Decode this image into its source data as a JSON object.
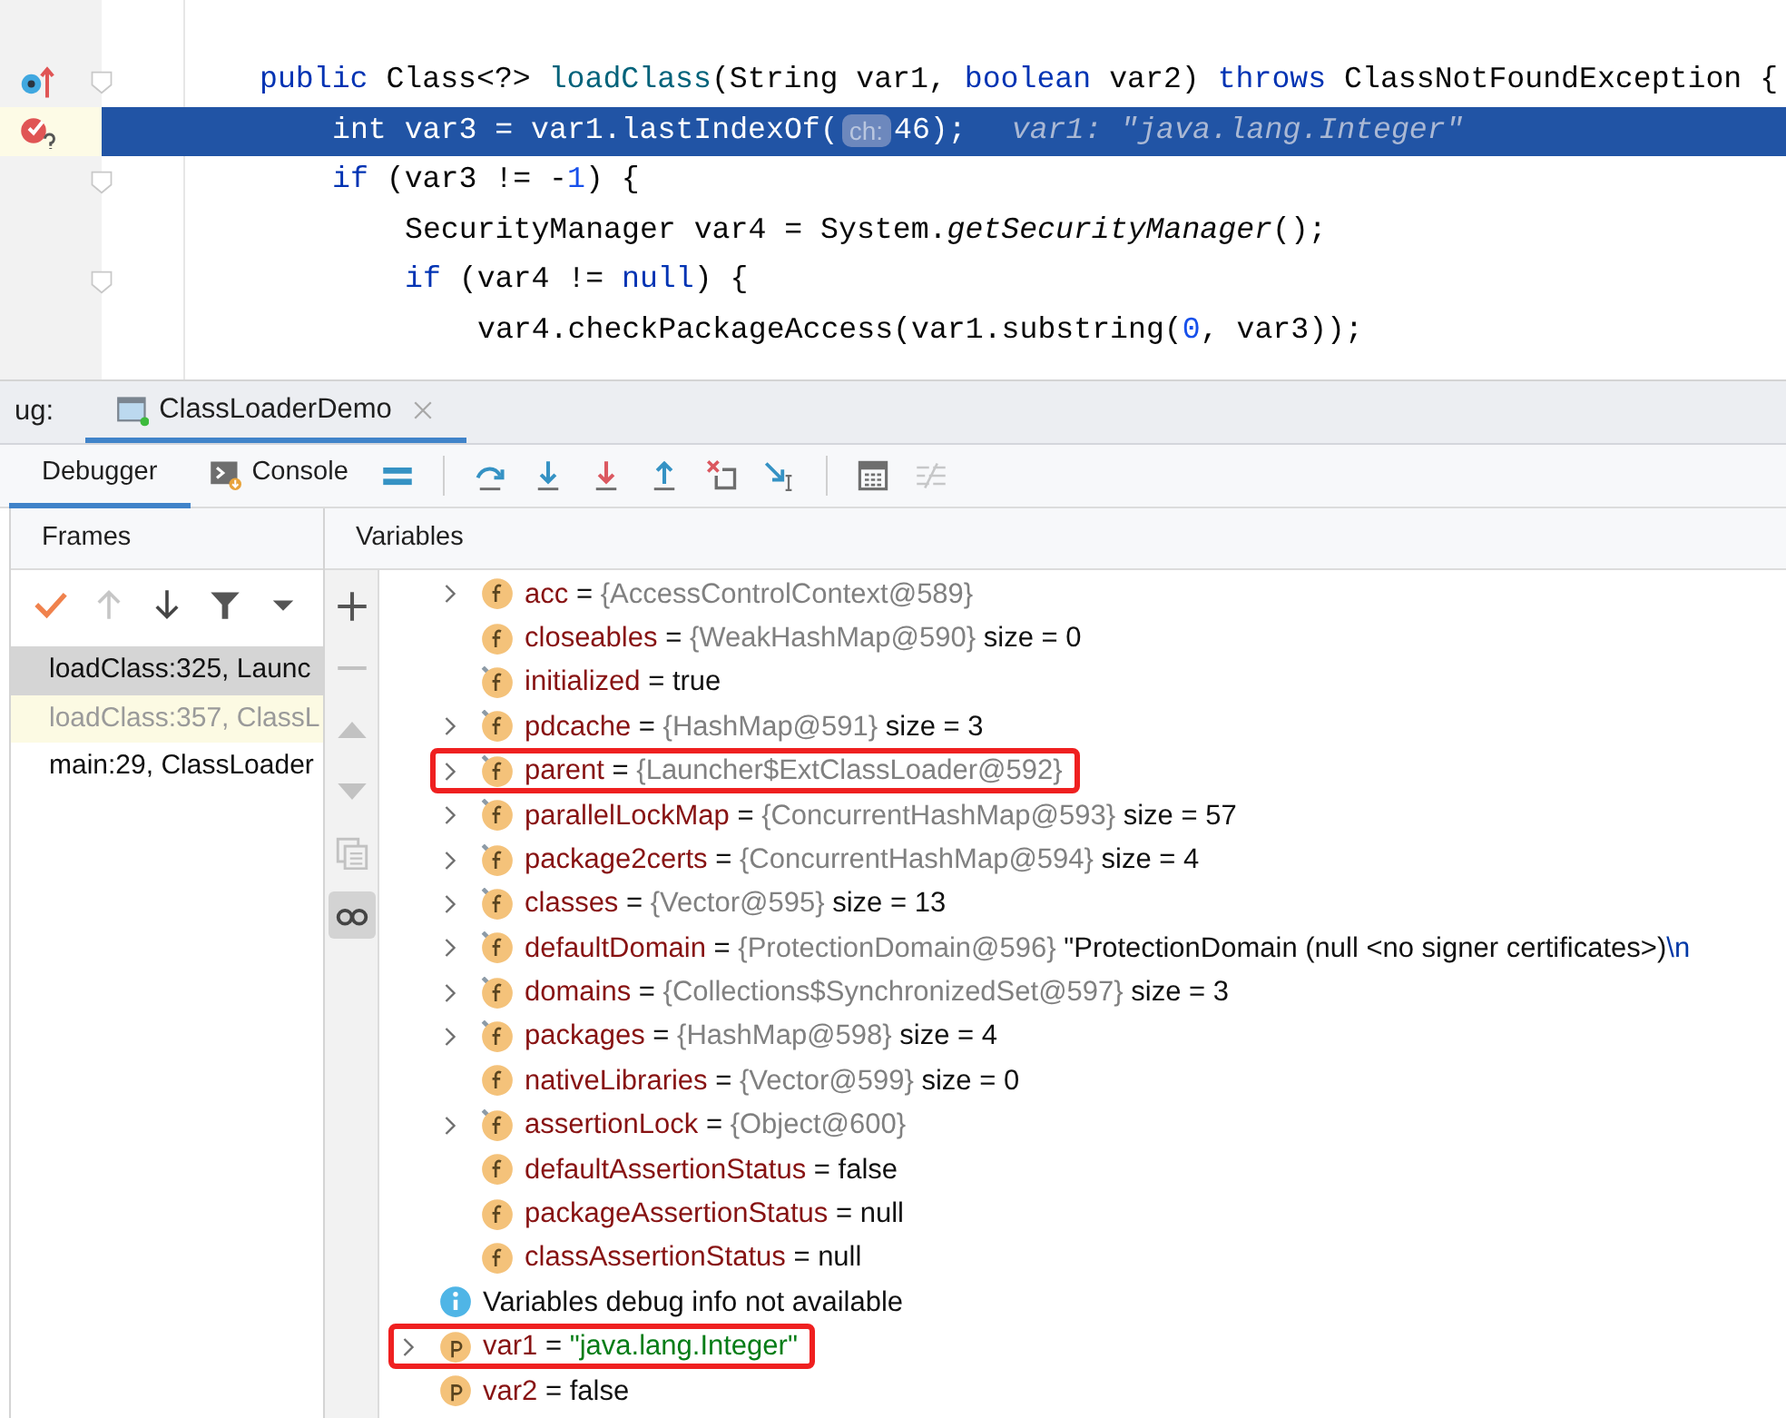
{
  "editor": {
    "lines": [
      {
        "kind": "override",
        "fold": true,
        "current": false,
        "tokens": [
          {
            "text": "public",
            "kind": "keyword"
          },
          {
            "text": " Class<?> ",
            "kind": "plain"
          },
          {
            "text": "loadClass",
            "kind": "declaration"
          },
          {
            "text": "(String var1, ",
            "kind": "plain"
          },
          {
            "text": "boolean",
            "kind": "keyword"
          },
          {
            "text": " var2) ",
            "kind": "plain"
          },
          {
            "text": "throws",
            "kind": "keyword"
          },
          {
            "text": " ClassNotFoundException {",
            "kind": "plain"
          }
        ],
        "children": [
          {
            "kind": "breakpoint",
            "fold": false,
            "current": true,
            "tokens": [
              {
                "text": "int",
                "kind": "keyword"
              },
              {
                "text": " var3 = var1.lastIndexOf(",
                "kind": "plain"
              },
              {
                "text": "ch:",
                "kind": "hint"
              },
              {
                "text": "46);",
                "kind": "plain"
              },
              {
                "text": "var1: \"java.lang.Integer\"",
                "kind": "inline_value"
              }
            ]
          },
          {
            "kind": "plain",
            "fold": true,
            "current": false,
            "tokens": [
              {
                "text": "if",
                "kind": "keyword"
              },
              {
                "text": " (var3 != -",
                "kind": "plain"
              },
              {
                "text": "1",
                "kind": "number"
              },
              {
                "text": ") {",
                "kind": "plain"
              }
            ],
            "children": [
              {
                "fold": false,
                "current": false,
                "tokens": [
                  {
                    "text": "SecurityManager var4 = System.",
                    "kind": "plain"
                  },
                  {
                    "text": "getSecurityManager",
                    "kind": "italic"
                  },
                  {
                    "text": "();",
                    "kind": "plain"
                  }
                ]
              },
              {
                "fold": true,
                "current": false,
                "tokens": [
                  {
                    "text": "if",
                    "kind": "keyword"
                  },
                  {
                    "text": " (var4 != ",
                    "kind": "plain"
                  },
                  {
                    "text": "null",
                    "kind": "keyword"
                  },
                  {
                    "text": ") {",
                    "kind": "plain"
                  }
                ],
                "children": [
                  {
                    "fold": false,
                    "current": false,
                    "tokens": [
                      {
                        "text": "var4.checkPackageAccess(var1.substring(",
                        "kind": "plain"
                      },
                      {
                        "text": "0",
                        "kind": "number"
                      },
                      {
                        "text": ", var3));",
                        "kind": "plain"
                      }
                    ]
                  }
                ]
              }
            ]
          }
        ]
      }
    ]
  },
  "debug_bar": {
    "label": "ug:",
    "tab": {
      "title": "ClassLoaderDemo",
      "selected": true
    }
  },
  "toolbar": {
    "tabs": [
      {
        "label": "Debugger",
        "kind": "plain",
        "selected": true
      },
      {
        "label": "Console",
        "kind": "console",
        "selected": false
      }
    ],
    "actions": [
      {
        "kind": "menu",
        "disabled": false
      },
      {
        "kind": "separator"
      },
      {
        "kind": "step_over",
        "disabled": false
      },
      {
        "kind": "step_into",
        "disabled": false
      },
      {
        "kind": "force_step_into",
        "disabled": false
      },
      {
        "kind": "step_out",
        "disabled": false
      },
      {
        "kind": "drop_frame",
        "disabled": false
      },
      {
        "kind": "run_to_cursor",
        "disabled": false
      },
      {
        "kind": "separator"
      },
      {
        "kind": "evaluate",
        "disabled": false
      },
      {
        "kind": "trace",
        "disabled": true
      }
    ]
  },
  "frames": {
    "title": "Frames",
    "tools": [
      {
        "kind": "check",
        "disabled": false
      },
      {
        "kind": "up",
        "disabled": true
      },
      {
        "kind": "down",
        "disabled": false
      },
      {
        "kind": "filter",
        "disabled": false
      },
      {
        "kind": "dropdown",
        "disabled": false
      }
    ],
    "items": [
      {
        "label": "loadClass:325, Launc",
        "selected": true,
        "library": false
      },
      {
        "label": "loadClass:357, ClassL",
        "selected": false,
        "library": true
      },
      {
        "label": "main:29, ClassLoader",
        "selected": false,
        "library": false
      }
    ]
  },
  "variables": {
    "title": "Variables",
    "tools": [
      {
        "kind": "plus",
        "disabled": false,
        "selected": false
      },
      {
        "kind": "minus",
        "disabled": true,
        "selected": false
      },
      {
        "kind": "up",
        "disabled": true,
        "selected": false
      },
      {
        "kind": "down",
        "disabled": true,
        "selected": false
      },
      {
        "kind": "copy",
        "disabled": true,
        "selected": false
      },
      {
        "kind": "glasses",
        "disabled": false,
        "selected": true
      }
    ],
    "fields_of_scrolled_object": [
      {
        "kind": "field",
        "final": false,
        "expandable": true,
        "annotated": false,
        "name": "acc",
        "value": [
          {
            "text": "=",
            "kind": "plain"
          },
          {
            "text": "{AccessControlContext@589}",
            "kind": "object"
          }
        ]
      },
      {
        "kind": "field",
        "final": false,
        "expandable": false,
        "annotated": false,
        "name": "closeables",
        "value": [
          {
            "text": "=",
            "kind": "plain"
          },
          {
            "text": "{WeakHashMap@590}",
            "kind": "object"
          },
          {
            "text": "size = 0",
            "kind": "plain"
          }
        ]
      },
      {
        "kind": "field",
        "final": true,
        "expandable": false,
        "annotated": false,
        "name": "initialized",
        "value": [
          {
            "text": "=",
            "kind": "plain"
          },
          {
            "text": "true",
            "kind": "plain"
          }
        ]
      },
      {
        "kind": "field",
        "final": true,
        "expandable": true,
        "annotated": false,
        "name": "pdcache",
        "value": [
          {
            "text": "=",
            "kind": "plain"
          },
          {
            "text": "{HashMap@591}",
            "kind": "object"
          },
          {
            "text": "size = 3",
            "kind": "plain"
          }
        ]
      },
      {
        "kind": "field",
        "final": true,
        "expandable": true,
        "annotated": true,
        "name": "parent",
        "value": [
          {
            "text": "=",
            "kind": "plain"
          },
          {
            "text": "{Launcher$ExtClassLoader@592}",
            "kind": "object"
          }
        ]
      },
      {
        "kind": "field",
        "final": true,
        "expandable": true,
        "annotated": false,
        "name": "parallelLockMap",
        "value": [
          {
            "text": "=",
            "kind": "plain"
          },
          {
            "text": "{ConcurrentHashMap@593}",
            "kind": "object"
          },
          {
            "text": "size = 57",
            "kind": "plain"
          }
        ]
      },
      {
        "kind": "field",
        "final": true,
        "expandable": true,
        "annotated": false,
        "name": "package2certs",
        "value": [
          {
            "text": "=",
            "kind": "plain"
          },
          {
            "text": "{ConcurrentHashMap@594}",
            "kind": "object"
          },
          {
            "text": "size = 4",
            "kind": "plain"
          }
        ]
      },
      {
        "kind": "field",
        "final": true,
        "expandable": true,
        "annotated": false,
        "name": "classes",
        "value": [
          {
            "text": "=",
            "kind": "plain"
          },
          {
            "text": "{Vector@595}",
            "kind": "object"
          },
          {
            "text": "size = 13",
            "kind": "plain"
          }
        ]
      },
      {
        "kind": "field",
        "final": true,
        "expandable": true,
        "annotated": false,
        "name": "defaultDomain",
        "value": [
          {
            "text": "=",
            "kind": "plain"
          },
          {
            "text": "{ProtectionDomain@596}",
            "kind": "object"
          },
          {
            "text": "\"ProtectionDomain  (null <no signer certificates>)",
            "kind": "plain"
          },
          {
            "text": "\\n",
            "kind": "escape"
          }
        ]
      },
      {
        "kind": "field",
        "final": true,
        "expandable": true,
        "annotated": false,
        "name": "domains",
        "value": [
          {
            "text": "=",
            "kind": "plain"
          },
          {
            "text": "{Collections$SynchronizedSet@597}",
            "kind": "object"
          },
          {
            "text": "size = 3",
            "kind": "plain"
          }
        ]
      },
      {
        "kind": "field",
        "final": true,
        "expandable": true,
        "annotated": false,
        "name": "packages",
        "value": [
          {
            "text": "=",
            "kind": "plain"
          },
          {
            "text": "{HashMap@598}",
            "kind": "object"
          },
          {
            "text": "size = 4",
            "kind": "plain"
          }
        ]
      },
      {
        "kind": "field",
        "final": false,
        "expandable": false,
        "annotated": false,
        "name": "nativeLibraries",
        "value": [
          {
            "text": "=",
            "kind": "plain"
          },
          {
            "text": "{Vector@599}",
            "kind": "object"
          },
          {
            "text": "size = 0",
            "kind": "plain"
          }
        ]
      },
      {
        "kind": "field",
        "final": true,
        "expandable": true,
        "annotated": false,
        "name": "assertionLock",
        "value": [
          {
            "text": "=",
            "kind": "plain"
          },
          {
            "text": "{Object@600}",
            "kind": "object"
          }
        ]
      },
      {
        "kind": "field",
        "final": false,
        "expandable": false,
        "annotated": false,
        "name": "defaultAssertionStatus",
        "value": [
          {
            "text": "=",
            "kind": "plain"
          },
          {
            "text": "false",
            "kind": "plain"
          }
        ]
      },
      {
        "kind": "field",
        "final": false,
        "expandable": false,
        "annotated": false,
        "name": "packageAssertionStatus",
        "value": [
          {
            "text": "=",
            "kind": "plain"
          },
          {
            "text": "null",
            "kind": "plain"
          }
        ]
      },
      {
        "kind": "field",
        "final": false,
        "expandable": false,
        "annotated": false,
        "name": "classAssertionStatus",
        "value": [
          {
            "text": "=",
            "kind": "plain"
          },
          {
            "text": "null",
            "kind": "plain"
          }
        ]
      }
    ],
    "locals": [
      {
        "kind": "info",
        "final": false,
        "expandable": false,
        "annotated": false,
        "message": "Variables debug info not available"
      },
      {
        "kind": "param",
        "final": false,
        "expandable": true,
        "annotated": true,
        "name": "var1",
        "value": [
          {
            "text": "=",
            "kind": "plain"
          },
          {
            "text": "\"java.lang.Integer\"",
            "kind": "string"
          }
        ]
      },
      {
        "kind": "param",
        "final": false,
        "expandable": false,
        "annotated": false,
        "name": "var2",
        "value": [
          {
            "text": "=",
            "kind": "plain"
          },
          {
            "text": "false",
            "kind": "plain"
          }
        ]
      }
    ]
  }
}
